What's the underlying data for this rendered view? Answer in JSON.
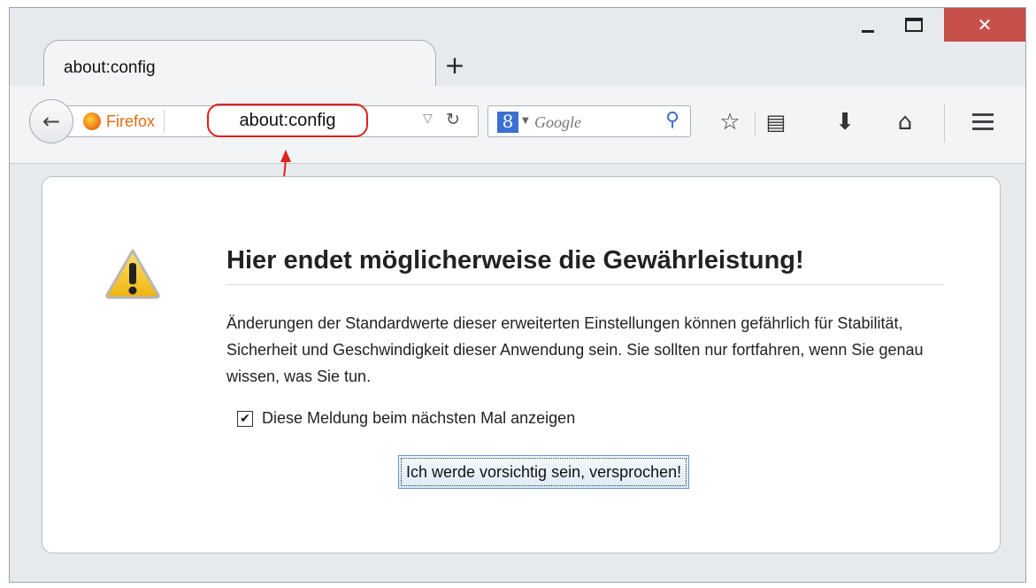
{
  "window": {
    "minimize_label": "Minimieren",
    "maximize_label": "Maximieren",
    "close_label": "Schließen"
  },
  "tabs": [
    {
      "label": "about:config"
    }
  ],
  "toolbar": {
    "identity_label": "Firefox",
    "url": "about:config",
    "search_engine": "8",
    "search_placeholder": "Google",
    "icons": [
      "back-icon",
      "firefox-icon",
      "dropdown-icon",
      "reload-icon",
      "search-engine-icon",
      "search-icon",
      "bookmark-star-icon",
      "reading-list-icon",
      "download-icon",
      "home-icon",
      "menu-icon"
    ]
  },
  "page": {
    "title": "Hier endet möglicherweise die Gewährleistung!",
    "body": "Änderungen der Standardwerte dieser erweiterten Einstellungen können gefährlich für Stabilität, Sicherheit und Geschwindigkeit dieser Anwendung sein. Sie sollten nur fortfahren, wenn Sie genau wissen, was Sie tun.",
    "checkbox_label": "Diese Meldung beim nächsten Mal anzeigen",
    "checkbox_checked": true,
    "confirm_button": "Ich werde vorsichtig sein, versprochen!"
  },
  "colors": {
    "highlight": "#e02020",
    "close_button": "#c7504b",
    "firefox_orange": "#e26b12",
    "button_border": "#5e96cf"
  }
}
